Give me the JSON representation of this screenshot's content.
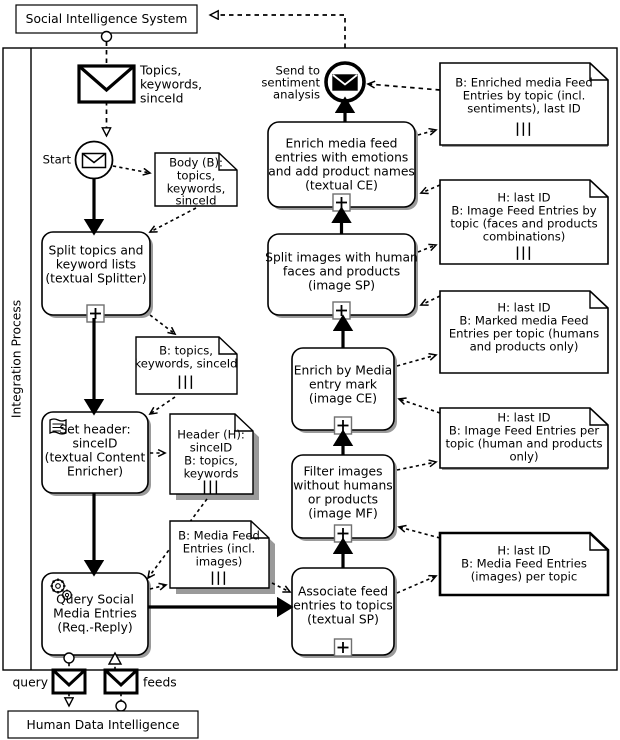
{
  "diagram": {
    "type": "BPMN collaboration diagram",
    "external_participants": [
      {
        "id": "social-intelligence-system",
        "label": "Social Intelligence System"
      },
      {
        "id": "human-data-intelligence",
        "label": "Human Data Intelligence"
      }
    ],
    "pool": {
      "lane_label": "Integration Process"
    },
    "messages": [
      {
        "id": "topics-message",
        "lines": [
          "Topics,",
          "keywords,",
          "sinceId"
        ]
      },
      {
        "id": "query-message",
        "label": "query"
      },
      {
        "id": "feeds-message",
        "label": "feeds"
      }
    ],
    "events": [
      {
        "id": "start-event",
        "label": "Start",
        "icon": "envelope-icon"
      },
      {
        "id": "end-event",
        "lines": [
          "Send to",
          "sentiment",
          "analysis"
        ],
        "icon": "envelope-icon"
      }
    ],
    "tasks": [
      {
        "id": "split-topics-task",
        "lines": [
          "Split topics and",
          "keyword lists",
          "(textual Splitter)"
        ],
        "marker": "+",
        "icon": "none"
      },
      {
        "id": "set-header-task",
        "lines": [
          "Set header:",
          "sinceID",
          "(textual Content",
          "Enricher)"
        ],
        "marker": "",
        "icon": "script-icon"
      },
      {
        "id": "query-social-media-task",
        "lines": [
          "Query Social",
          "Media Entries",
          "(Req.-Reply)"
        ],
        "marker": "",
        "icon": "gears-icon"
      },
      {
        "id": "associate-feed-entries-task",
        "lines": [
          "Associate feed",
          "entries to topics",
          "(textual SP)"
        ],
        "marker": "+",
        "icon": "none"
      },
      {
        "id": "filter-images-task",
        "lines": [
          "Filter images",
          "without humans",
          "or products",
          "(image MF)"
        ],
        "marker": "+",
        "icon": "none"
      },
      {
        "id": "enrich-media-mark-task",
        "lines": [
          "Enrich by Media",
          "entry mark",
          "(image CE)"
        ],
        "marker": "+",
        "icon": "none"
      },
      {
        "id": "split-images-task",
        "lines": [
          "Split images with human",
          "faces and products",
          "(image SP)"
        ],
        "marker": "+",
        "icon": "none"
      },
      {
        "id": "enrich-emotions-task",
        "lines": [
          "Enrich media feed",
          "entries with emotions",
          "and add product names",
          "(textual CE)"
        ],
        "marker": "+",
        "icon": "none"
      }
    ],
    "data_objects": [
      {
        "id": "body-topics-data",
        "lines": [
          "Body (B):",
          "topics,",
          "keywords,",
          "sinceId"
        ],
        "collection": false
      },
      {
        "id": "b-topics-keywords-data",
        "lines": [
          "B: topics,",
          "keywords, sinceId"
        ],
        "collection": true,
        "collection_mark": "|||"
      },
      {
        "id": "header-sinceid-data",
        "lines": [
          "Header (H):",
          "sinceID",
          "B: topics,",
          "keywords"
        ],
        "collection": true,
        "collection_mark": "|||"
      },
      {
        "id": "b-media-feed-entries-data",
        "lines": [
          "B: Media Feed",
          "Entries (incl.",
          "images)"
        ],
        "collection": true,
        "collection_mark": "|||"
      },
      {
        "id": "media-feed-entries-per-topic-data",
        "lines": [
          "H: last ID",
          "B: Media Feed Entries",
          "(images) per topic"
        ],
        "collection": false
      },
      {
        "id": "image-feed-entries-per-topic-data",
        "lines": [
          "H: last ID",
          "B: Image Feed Entries per",
          "topic (human and products",
          "only)"
        ],
        "collection": false
      },
      {
        "id": "marked-media-feed-entries-data",
        "lines": [
          "H: last ID",
          "B: Marked media Feed",
          "Entries per topic (humans",
          "and products only)"
        ],
        "collection": false
      },
      {
        "id": "image-feed-entries-by-topic-data",
        "lines": [
          "H: last ID",
          "B: Image Feed Entries by",
          "topic (faces and products",
          "combinations)"
        ],
        "collection": true,
        "collection_mark": "|||"
      },
      {
        "id": "enriched-media-feed-entries-data",
        "lines": [
          "B: Enriched media Feed",
          "Entries by topic (incl.",
          "sentiments), last ID"
        ],
        "collection": true,
        "collection_mark": "|||"
      }
    ],
    "colors": {
      "stroke": "#000000",
      "fill": "#ffffff",
      "shadow": "#9a9a9a"
    }
  }
}
